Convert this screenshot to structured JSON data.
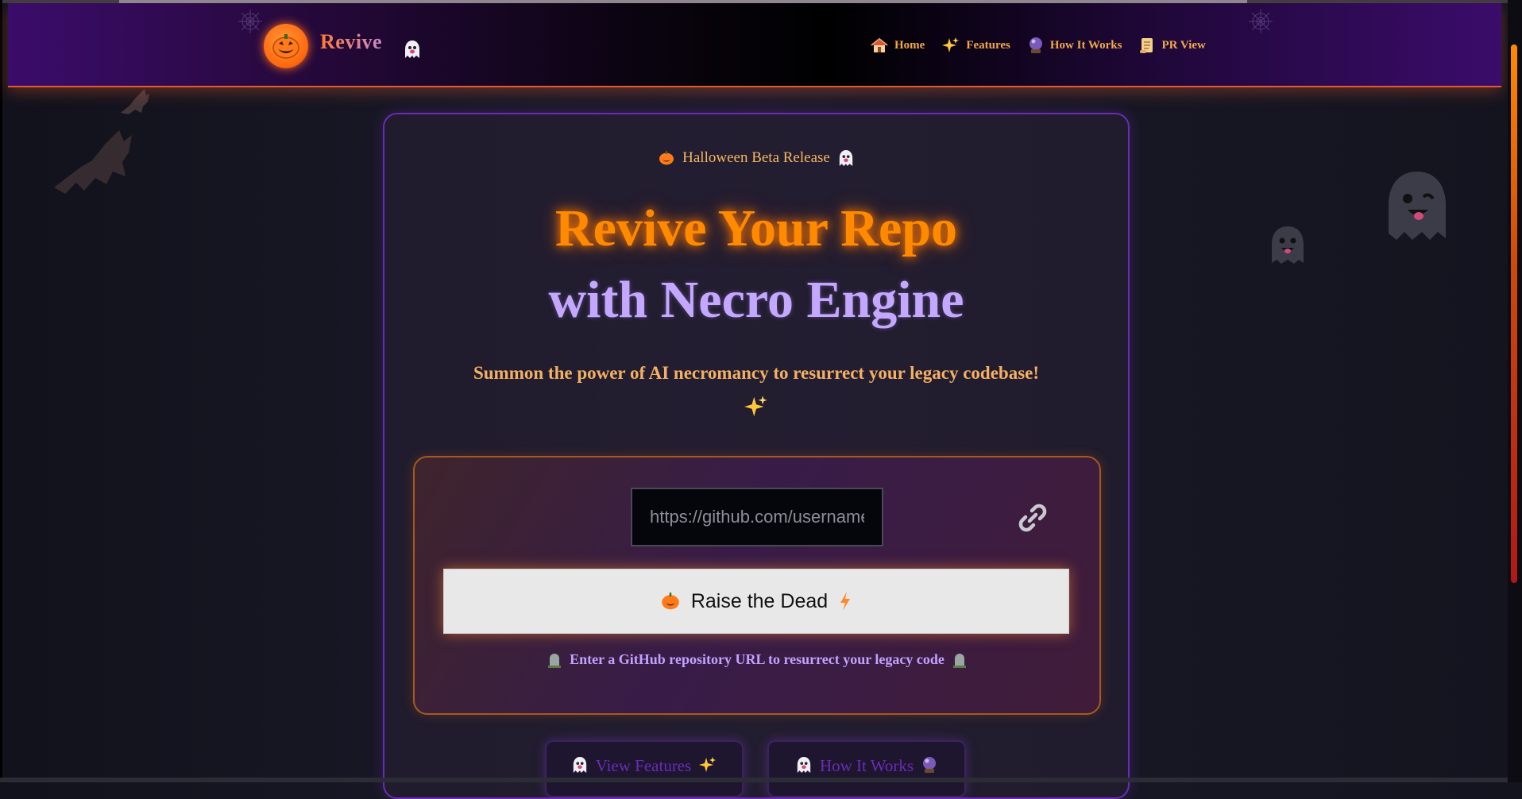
{
  "header": {
    "brand": "Revive",
    "nav": [
      {
        "label": "Home",
        "icon": "house-icon"
      },
      {
        "label": "Features",
        "icon": "sparkles-icon"
      },
      {
        "label": "How It Works",
        "icon": "crystal-ball-icon"
      },
      {
        "label": "PR View",
        "icon": "scroll-icon"
      }
    ]
  },
  "hero": {
    "badge": "Halloween Beta Release",
    "title_line1": "Revive Your Repo",
    "title_line2": "with Necro Engine",
    "subtitle": "Summon the power of AI necromancy to resurrect your legacy codebase!"
  },
  "form": {
    "url_placeholder": "https://github.com/username/repo",
    "submit_label": "Raise the Dead",
    "hint": "Enter a GitHub repository URL to resurrect your legacy code"
  },
  "actions": {
    "view_features": "View Features",
    "how_it_works": "How It Works"
  },
  "colors": {
    "accent_orange": "#ff8a00",
    "accent_purple": "#c4a8ff",
    "nav_text": "#f2a94a",
    "header_border": "#e8592a"
  }
}
